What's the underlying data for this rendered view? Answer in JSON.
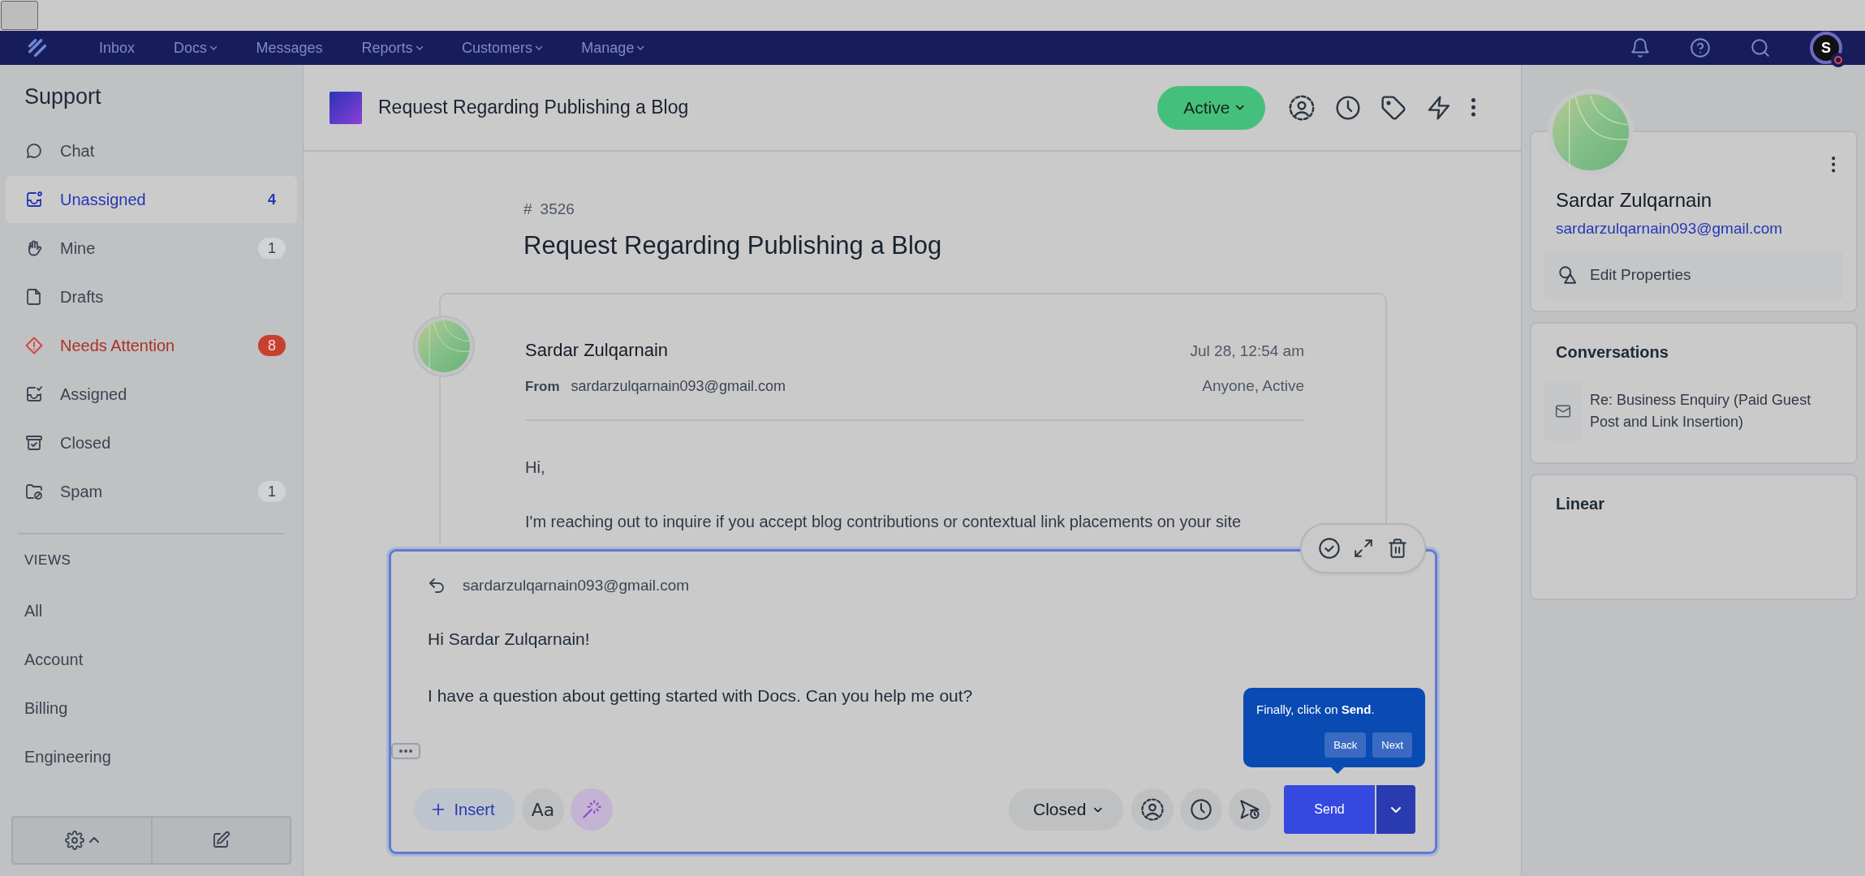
{
  "top_bar": {
    "items": [
      {
        "label": "Inbox",
        "menu": false
      },
      {
        "label": "Docs",
        "menu": true
      },
      {
        "label": "Messages",
        "menu": false
      },
      {
        "label": "Reports",
        "menu": true
      },
      {
        "label": "Customers",
        "menu": true
      },
      {
        "label": "Manage",
        "menu": true
      }
    ],
    "avatar_letter": "S"
  },
  "sidebar": {
    "title": "Support",
    "items": [
      {
        "kind": "chat",
        "label": "Chat",
        "selected": false,
        "alert": false
      },
      {
        "kind": "unassigned",
        "label": "Unassigned",
        "count": "4",
        "selected": true,
        "alert": false
      },
      {
        "kind": "mine",
        "label": "Mine",
        "count": "1",
        "selected": false,
        "alert": false
      },
      {
        "kind": "drafts",
        "label": "Drafts",
        "selected": false,
        "alert": false
      },
      {
        "kind": "attention",
        "label": "Needs Attention",
        "count": "8",
        "selected": false,
        "alert": true
      },
      {
        "kind": "assigned",
        "label": "Assigned",
        "selected": false,
        "alert": false
      },
      {
        "kind": "closed",
        "label": "Closed",
        "selected": false,
        "alert": false
      },
      {
        "kind": "spam",
        "label": "Spam",
        "count": "1",
        "selected": false,
        "alert": false
      }
    ],
    "views_heading": "VIEWS",
    "views": [
      "All",
      "Account",
      "Billing",
      "Engineering"
    ]
  },
  "conversation": {
    "title": "Request Regarding Publishing a Blog",
    "status": "Active",
    "number_sign": "#",
    "number": "3526",
    "heading": "Request Regarding Publishing a Blog",
    "message": {
      "sender": "Sardar Zulqarnain",
      "from_label": "From",
      "from_email": "sardarzulqarnain093@gmail.com",
      "time": "Jul 28, 12:54 am",
      "assignment": "Anyone, Active",
      "body": [
        "Hi,",
        "I'm reaching out to inquire if you accept blog contributions or contextual link placements on your site"
      ]
    }
  },
  "composer": {
    "to": "sardarzulqarnain093@gmail.com",
    "body": [
      "Hi Sardar Zulqarnain!",
      "I have a question about getting started with Docs. Can you help me out?"
    ],
    "insert_label": "Insert",
    "format_label": "Aa",
    "state": "Closed",
    "send_label": "Send"
  },
  "tour_tip": {
    "text": "Finally, click on **Send**.",
    "buttons": [
      "Back",
      "Next"
    ]
  },
  "customer": {
    "name": "Sardar Zulqarnain",
    "email": "sardarzulqarnain093@gmail.com",
    "edit_label": "Edit Properties",
    "conversations_title": "Conversations",
    "conversations": [
      "Re: Business Enquiry (Paid Guest Post and Link Insertion)"
    ],
    "linear_title": "Linear"
  }
}
